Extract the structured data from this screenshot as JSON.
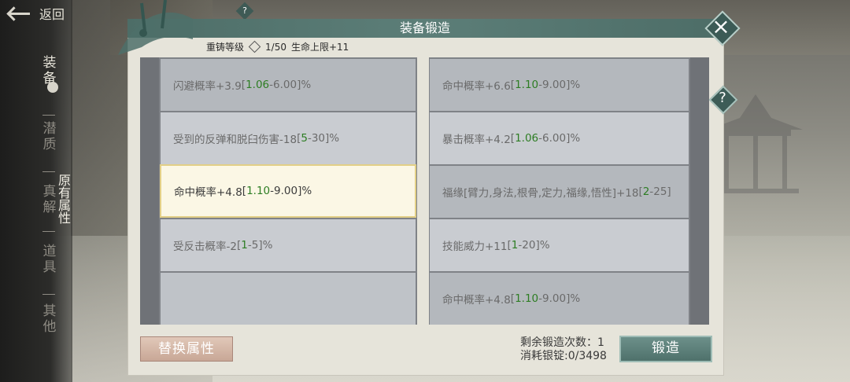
{
  "header": {
    "back_label": "返回",
    "help_small": "?"
  },
  "sidebar": {
    "items": [
      {
        "label": "装备",
        "active": true
      },
      {
        "label": "潜质",
        "active": false
      },
      {
        "label": "真解",
        "active": false
      },
      {
        "label": "道具",
        "active": false
      },
      {
        "label": "其他",
        "active": false
      }
    ],
    "sub_item": "原有属性"
  },
  "panel": {
    "title": "装备锻造",
    "close_icon": "×",
    "help_icon": "?",
    "reforge_label": "重铸等级",
    "reforge_value": "1/50",
    "reforge_bonus": "生命上限+11"
  },
  "left_attrs": [
    {
      "name": "闪避概率+3.9",
      "min": "1.06",
      "max": "6.00",
      "suffix": "%"
    },
    {
      "name": "受到的反弹和脱臼伤害-18",
      "min": "5",
      "max": "30",
      "suffix": "%"
    },
    {
      "name": "命中概率+4.8",
      "min": "1.10",
      "max": "9.00",
      "suffix": "%"
    },
    {
      "name": "受反击概率-2",
      "min": "1",
      "max": "5",
      "suffix": "%"
    }
  ],
  "right_attrs": [
    {
      "name": "命中概率+6.6",
      "min": "1.10",
      "max": "9.00",
      "suffix": "%"
    },
    {
      "name": "暴击概率+4.2",
      "min": "1.06",
      "max": "6.00",
      "suffix": "%"
    },
    {
      "name": "福缘[臂力,身法,根骨,定力,福缘,悟性]+18",
      "min": "2",
      "max": "25",
      "suffix": ""
    },
    {
      "name": "技能威力+11",
      "min": "1",
      "max": "20",
      "suffix": "%"
    },
    {
      "name": "命中概率+4.8",
      "min": "1.10",
      "max": "9.00",
      "suffix": "%"
    }
  ],
  "footer": {
    "replace_label": "替换属性",
    "remaining_label": "剩余锻造次数：1",
    "cost_label": "消耗银锭:0/3498",
    "forge_label": "锻造"
  },
  "colors": {
    "accent": "#4d6d67",
    "highlight_green": "#2d7d23",
    "selected_border": "#e2cf86"
  }
}
